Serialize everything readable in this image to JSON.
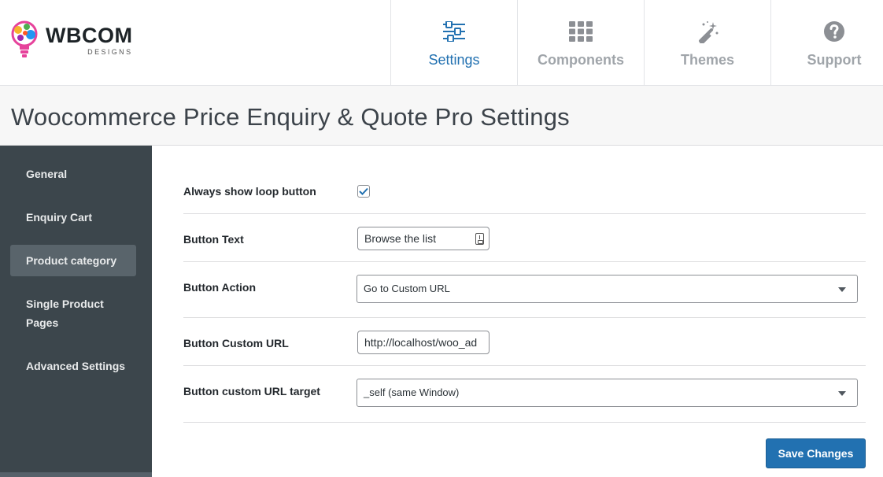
{
  "brand": {
    "name": "WBCOM",
    "tagline": "DESIGNS"
  },
  "nav": {
    "tabs": [
      {
        "label": "Settings",
        "icon": "sliders-icon",
        "active": true
      },
      {
        "label": "Components",
        "icon": "grid-icon",
        "active": false
      },
      {
        "label": "Themes",
        "icon": "magic-wand-icon",
        "active": false
      },
      {
        "label": "Support",
        "icon": "question-circle-icon",
        "active": false
      }
    ]
  },
  "page": {
    "title": "Woocommerce Price Enquiry & Quote Pro Settings"
  },
  "sidebar": {
    "items": [
      {
        "label": "General"
      },
      {
        "label": "Enquiry Cart"
      },
      {
        "label": "Product category",
        "active": true
      },
      {
        "label": "Single Product Pages"
      },
      {
        "label": "Advanced Settings"
      }
    ]
  },
  "form": {
    "always_show_loop": {
      "label": "Always show loop button",
      "checked": true
    },
    "button_text": {
      "label": "Button Text",
      "value": "Browse the list"
    },
    "button_action": {
      "label": "Button Action",
      "value": "Go to Custom URL"
    },
    "button_custom_url": {
      "label": "Button Custom URL",
      "value": "http://localhost/woo_ad"
    },
    "button_url_target": {
      "label": "Button custom URL target",
      "value": "_self (same Window)"
    },
    "save_label": "Save Changes"
  },
  "colors": {
    "accent": "#2271b1",
    "sidebar_bg": "#3c464c",
    "sidebar_active": "#59646b"
  }
}
